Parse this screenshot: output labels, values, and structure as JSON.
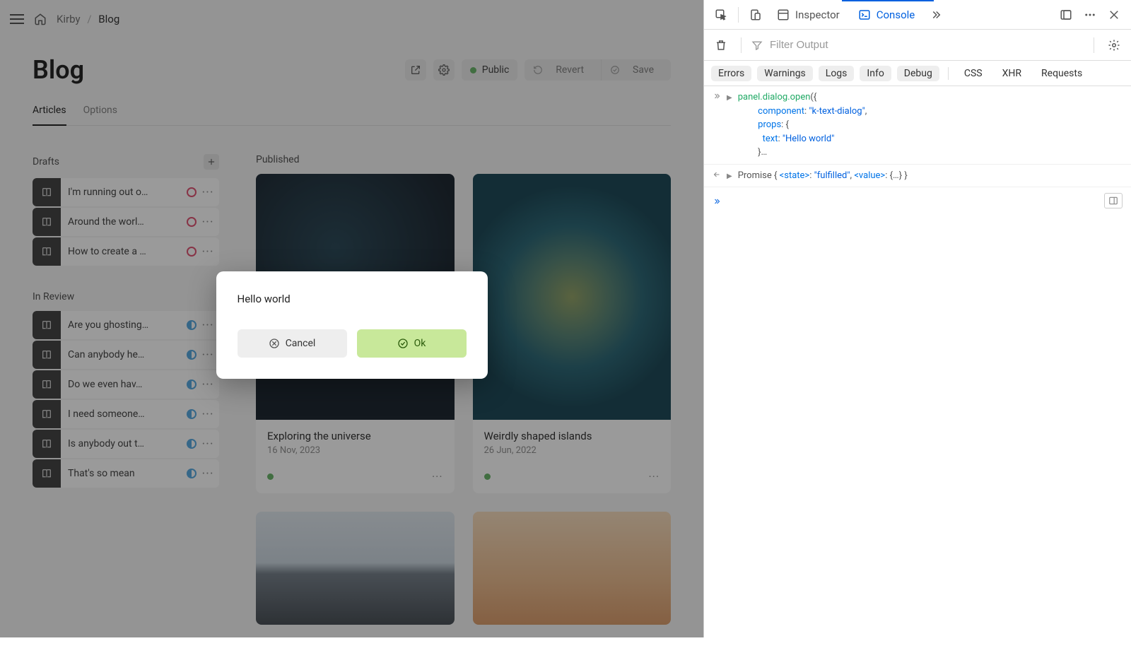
{
  "breadcrumb": {
    "root": "Kirby",
    "current": "Blog"
  },
  "page": {
    "title": "Blog"
  },
  "tabs": [
    {
      "label": "Articles",
      "active": true
    },
    {
      "label": "Options",
      "active": false
    }
  ],
  "header_actions": {
    "status_label": "Public",
    "revert_label": "Revert",
    "save_label": "Save"
  },
  "sections": {
    "drafts": {
      "title": "Drafts",
      "items": [
        {
          "label": "I'm running out o…"
        },
        {
          "label": "Around the worl…"
        },
        {
          "label": "How to create a …"
        }
      ]
    },
    "in_review": {
      "title": "In Review",
      "items": [
        {
          "label": "Are you ghosting…"
        },
        {
          "label": "Can anybody he…"
        },
        {
          "label": "Do we even hav…"
        },
        {
          "label": "I need someone…"
        },
        {
          "label": "Is anybody out t…"
        },
        {
          "label": "That's so mean"
        }
      ]
    },
    "published": {
      "title": "Published",
      "cards": [
        {
          "title": "Exploring the universe",
          "date": "16 Nov, 2023"
        },
        {
          "title": "Weirdly shaped islands",
          "date": "26 Jun, 2022"
        }
      ]
    }
  },
  "dialog": {
    "text": "Hello world",
    "cancel": "Cancel",
    "ok": "Ok"
  },
  "devtools": {
    "tabs": {
      "inspector": "Inspector",
      "console": "Console"
    },
    "filter_placeholder": "Filter Output",
    "chips": [
      "Errors",
      "Warnings",
      "Logs",
      "Info",
      "Debug"
    ],
    "chips_plain": [
      "CSS",
      "XHR",
      "Requests"
    ],
    "log_input": {
      "call": "panel.dialog.open",
      "open_brace": "({",
      "component_key": "component",
      "component_val": "\"k-text-dialog\"",
      "props_key": "props",
      "text_key": "text",
      "text_val": "\"Hello world\"",
      "ellipsis": "}…"
    },
    "log_output": {
      "promise": "Promise",
      "state_key": "<state>",
      "state_val": "\"fulfilled\"",
      "value_key": "<value>",
      "value_val": "{…}"
    }
  }
}
